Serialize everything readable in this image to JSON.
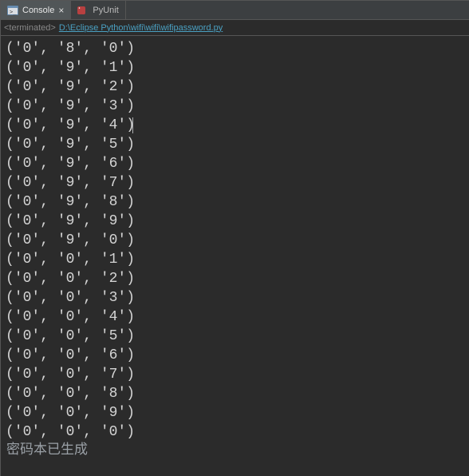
{
  "tabs": {
    "console": {
      "label": "Console"
    },
    "pyunit": {
      "label": "PyUnit"
    }
  },
  "path": {
    "status": "<terminated>",
    "text": "D:\\Eclipse Python\\wifi\\wifi\\wifipassword.py"
  },
  "output_lines": [
    "('0', '8', '0')",
    "('0', '9', '1')",
    "('0', '9', '2')",
    "('0', '9', '3')",
    "('0', '9', '4')",
    "('0', '9', '5')",
    "('0', '9', '6')",
    "('0', '9', '7')",
    "('0', '9', '8')",
    "('0', '9', '9')",
    "('0', '9', '0')",
    "('0', '0', '1')",
    "('0', '0', '2')",
    "('0', '0', '3')",
    "('0', '0', '4')",
    "('0', '0', '5')",
    "('0', '0', '6')",
    "('0', '0', '7')",
    "('0', '0', '8')",
    "('0', '0', '9')",
    "('0', '0', '0')"
  ],
  "status_message": "密码本已生成",
  "cursor_line_index": 4
}
